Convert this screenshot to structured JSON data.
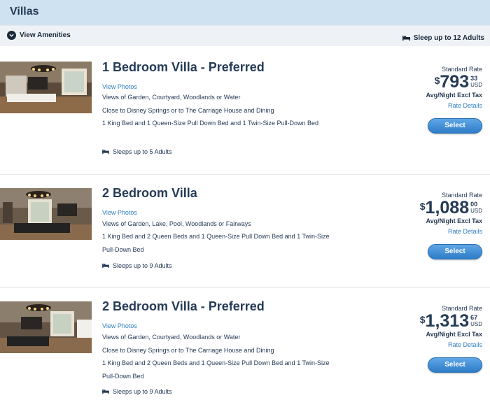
{
  "header": {
    "title": "Villas"
  },
  "amenities": {
    "toggle_label": "View Amenities",
    "sleep_summary": "Sleep up to 12 Adults",
    "toggle_icon": "chevron-down-icon",
    "sleep_icon": "bed-icon"
  },
  "colors": {
    "header_bg": "#cfe2f1",
    "link": "#2f7fc1",
    "button": "#3a8ad4",
    "title": "#253b56"
  },
  "rooms": [
    {
      "title": "1 Bedroom Villa - Preferred",
      "view_photos": "View Photos",
      "views": "Views of Garden, Courtyard, Woodlands or Water",
      "location": "Close to Disney Springs or to The Carriage House and Dining",
      "beds": "1 King Bed and 1 Queen-Size Pull Down Bed and 1 Twin-Size Pull-Down Bed",
      "sleeps": "Sleeps up to 5 Adults",
      "rate_label": "Standard Rate",
      "dollar_sign": "$",
      "price_whole": "793",
      "price_cents": "33",
      "currency": "USD",
      "price_note": "Avg/Night Excl Tax",
      "rate_details": "Rate Details",
      "select_label": "Select"
    },
    {
      "title": "2 Bedroom Villa",
      "view_photos": "View Photos",
      "views": "Views of Garden, Lake, Pool, Woodlands or Fairways",
      "beds": "1 King Bed and 2 Queen Beds and 1 Queen-Size Pull Down Bed and 1 Twin-Size Pull-Down Bed",
      "sleeps": "Sleeps up to 9 Adults",
      "rate_label": "Standard Rate",
      "dollar_sign": "$",
      "price_whole": "1,088",
      "price_cents": "00",
      "currency": "USD",
      "price_note": "Avg/Night Excl Tax",
      "rate_details": "Rate Details",
      "select_label": "Select"
    },
    {
      "title": "2 Bedroom Villa - Preferred",
      "view_photos": "View Photos",
      "views": "Views of Garden, Courtyard, Woodlands or Water",
      "location": "Close to Disney Springs or to The Carriage House and Dining",
      "beds": "1 King Bed and 2 Queen Beds and 1 Queen-Size Pull Down Bed and 1 Twin-Size Pull-Down Bed",
      "sleeps": "Sleeps up to 9 Adults",
      "rate_label": "Standard Rate",
      "dollar_sign": "$",
      "price_whole": "1,313",
      "price_cents": "67",
      "currency": "USD",
      "price_note": "Avg/Night Excl Tax",
      "rate_details": "Rate Details",
      "select_label": "Select"
    }
  ]
}
